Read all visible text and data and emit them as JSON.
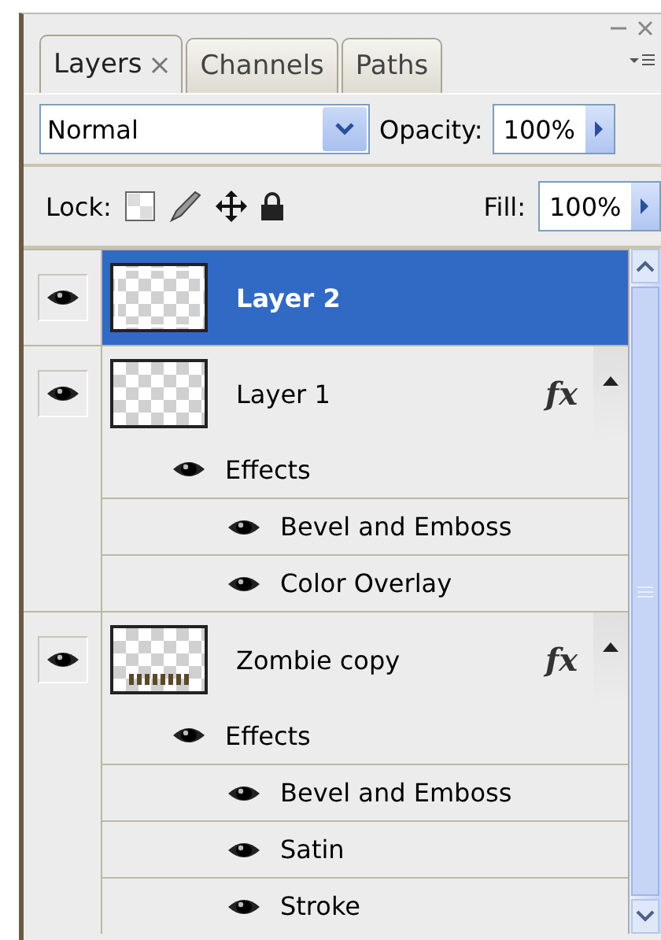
{
  "tabs": [
    {
      "label": "Layers",
      "selected": true,
      "closable": true
    },
    {
      "label": "Channels",
      "selected": false,
      "closable": false
    },
    {
      "label": "Paths",
      "selected": false,
      "closable": false
    }
  ],
  "blend_mode": "Normal",
  "opacity": {
    "label": "Opacity:",
    "value": "100%"
  },
  "lock": {
    "label": "Lock:"
  },
  "fill": {
    "label": "Fill:",
    "value": "100%"
  },
  "layers": [
    {
      "name": "Layer 2",
      "selected": true,
      "visible": true,
      "kind": "pixel"
    },
    {
      "name": "Layer 1",
      "selected": false,
      "visible": true,
      "kind": "pixel",
      "fx": "fx",
      "expanded": true,
      "children": [
        {
          "name": "Effects",
          "visible": true,
          "children": [
            {
              "name": "Bevel and Emboss",
              "visible": true
            },
            {
              "name": "Color Overlay",
              "visible": true
            }
          ]
        }
      ]
    },
    {
      "name": "Zombie copy",
      "selected": false,
      "visible": true,
      "kind": "text",
      "fx": "fx",
      "expanded": true,
      "children": [
        {
          "name": "Effects",
          "visible": true,
          "children": [
            {
              "name": "Bevel and Emboss",
              "visible": true
            },
            {
              "name": "Satin",
              "visible": true
            },
            {
              "name": "Stroke",
              "visible": true
            }
          ]
        }
      ]
    }
  ]
}
